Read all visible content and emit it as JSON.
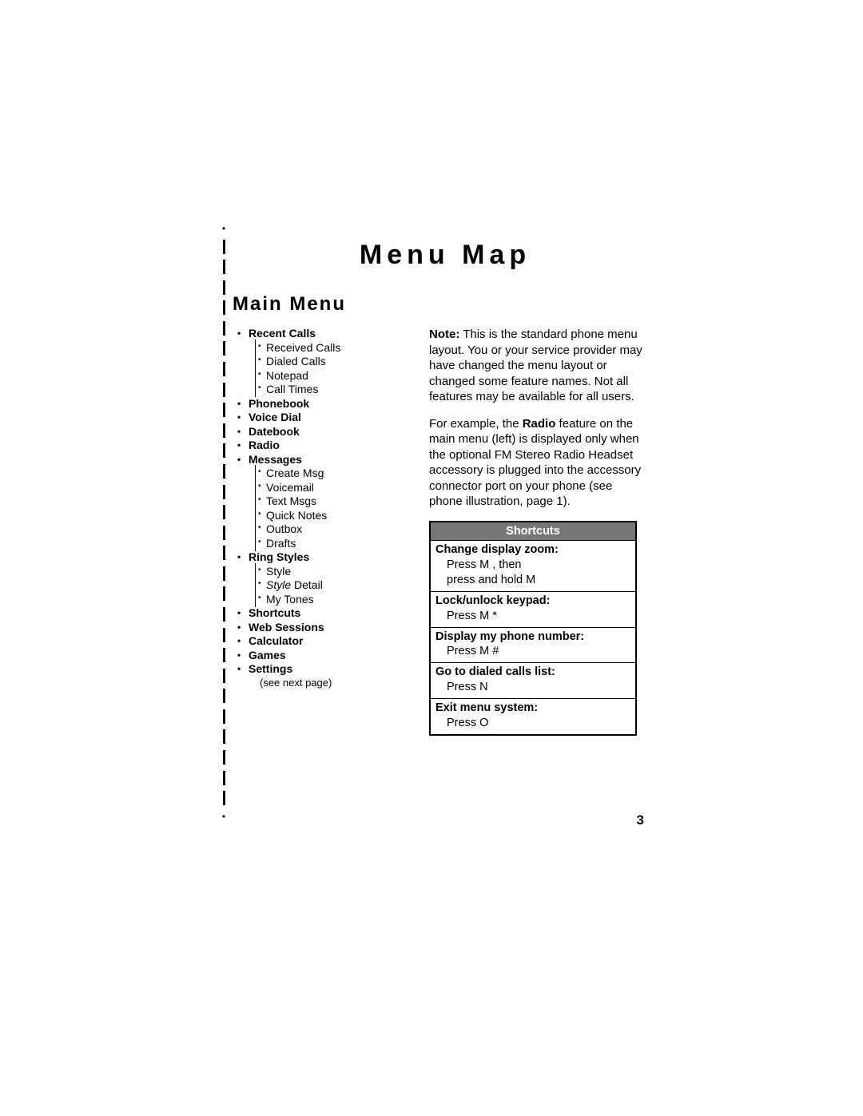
{
  "title": "Menu Map",
  "subtitle": "Main Menu",
  "menu": [
    {
      "label": "Recent Calls",
      "children": [
        "Received Calls",
        "Dialed Calls",
        "Notepad",
        "Call Times"
      ]
    },
    {
      "label": "Phonebook"
    },
    {
      "label": "Voice Dial"
    },
    {
      "label": "Datebook"
    },
    {
      "label": "Radio"
    },
    {
      "label": "Messages",
      "children": [
        "Create Msg",
        "Voicemail",
        "Text Msgs",
        "Quick Notes",
        "Outbox",
        "Drafts"
      ]
    },
    {
      "label": "Ring Styles",
      "children": [
        "Style",
        "Style Detail",
        "My Tones"
      ],
      "italicIdx": 1
    },
    {
      "label": "Shortcuts"
    },
    {
      "label": "Web Sessions"
    },
    {
      "label": "Calculator"
    },
    {
      "label": "Games"
    },
    {
      "label": "Settings",
      "note": "(see next page)"
    }
  ],
  "note_prefix": "Note:",
  "note_text": " This is the standard phone menu layout. You or your service provider may have changed the menu layout or changed some feature names. Not all features may be available for all users.",
  "example_pre": "For example, the ",
  "example_bold": "Radio",
  "example_post": " feature on the main menu (left) is displayed only when the optional FM Stereo Radio Headset accessory is plugged into the accessory connector port on your phone (see phone illustration, page 1).",
  "shortcuts_header": "Shortcuts",
  "shortcuts": [
    {
      "title": "Change display zoom:",
      "lines": [
        "Press M , then",
        "press and hold M"
      ]
    },
    {
      "title": "Lock/unlock keypad:",
      "lines": [
        "Press M  *"
      ]
    },
    {
      "title": "Display my phone number:",
      "lines": [
        "Press M  #"
      ]
    },
    {
      "title": "Go to dialed calls list:",
      "lines": [
        "Press N"
      ]
    },
    {
      "title": "Exit menu system:",
      "lines": [
        "Press O"
      ]
    }
  ],
  "page_number": "3"
}
